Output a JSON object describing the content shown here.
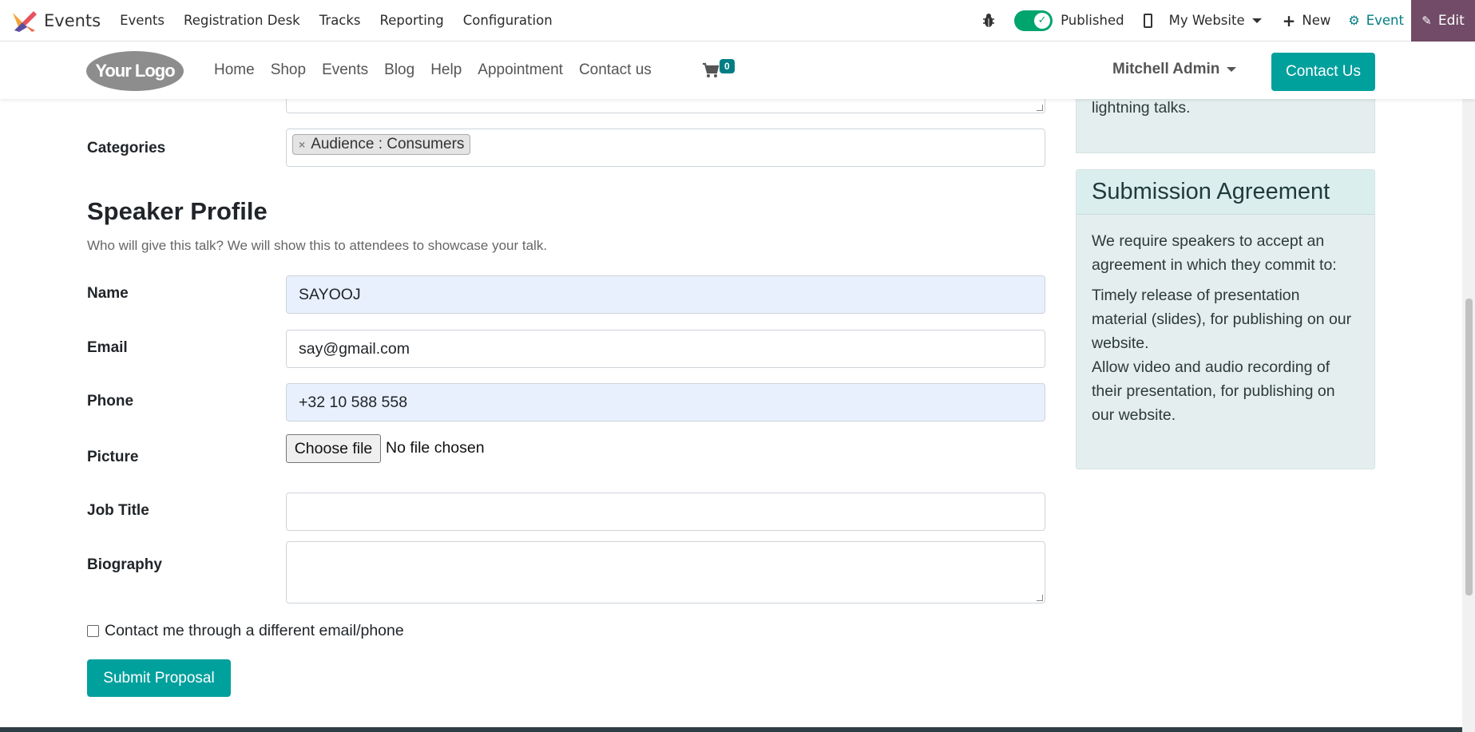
{
  "adminbar": {
    "app_name": "Events",
    "menu": [
      "Events",
      "Registration Desk",
      "Tracks",
      "Reporting",
      "Configuration"
    ],
    "published_label": "Published",
    "website_label": "My Website",
    "new_label": "New",
    "event_label": "Event",
    "edit_label": "Edit"
  },
  "site": {
    "logo_text": "Your Logo",
    "nav": [
      "Home",
      "Shop",
      "Events",
      "Blog",
      "Help",
      "Appointment",
      "Contact us"
    ],
    "cart_count": "0",
    "user": "Mitchell Admin",
    "contact_button": "Contact Us"
  },
  "form": {
    "categories_label": "Categories",
    "category_tag": "Audience : Consumers",
    "section_title": "Speaker Profile",
    "section_subtitle": "Who will give this talk? We will show this to attendees to showcase your talk.",
    "name_label": "Name",
    "name_value": "SAYOOJ",
    "email_label": "Email",
    "email_value": "say@gmail.com",
    "phone_label": "Phone",
    "phone_value": "+32 10 588 558",
    "picture_label": "Picture",
    "file_button": "Choose file",
    "file_status": "No file chosen",
    "job_title_label": "Job Title",
    "job_title_value": "",
    "biography_label": "Biography",
    "checkbox_label": "Contact me through a different email/phone",
    "submit_label": "Submit Proposal"
  },
  "sidebar": {
    "card1_tail": "lightning talks.",
    "agreement_title": "Submission Agreement",
    "agreement_intro": "We require speakers to accept an agreement in which they commit to:",
    "agreement_item_1": "Timely release of presentation material (slides), for publishing on our website.",
    "agreement_item_2": "Allow video and audio recording of their presentation, for publishing on our website."
  },
  "colors": {
    "primary": "#00a09d",
    "edit_bg": "#714b67",
    "toggle_on": "#00a46d",
    "card_bg": "#e5eeee"
  }
}
